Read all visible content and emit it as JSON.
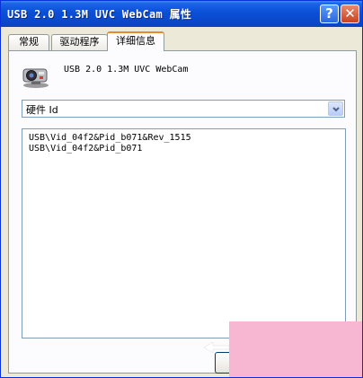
{
  "window": {
    "title": "USB 2.0 1.3M UVC WebCam 属性",
    "help_label": "?",
    "close_label": "✕"
  },
  "tabs": [
    {
      "label": "常规",
      "active": false
    },
    {
      "label": "驱动程序",
      "active": false
    },
    {
      "label": "详细信息",
      "active": true
    }
  ],
  "device": {
    "icon": "camera-icon",
    "name": "USB 2.0 1.3M UVC WebCam"
  },
  "property_select": {
    "value": "硬件 Id",
    "icon": "chevron-down-icon"
  },
  "values": [
    "USB\\Vid_04f2&Pid_b071&Rev_1515",
    "USB\\Vid_04f2&Pid_b071"
  ],
  "colors": {
    "titlebar": "#0a49cc",
    "active_tab_accent": "#e68b2c",
    "overlay": "#f7b7d2"
  }
}
